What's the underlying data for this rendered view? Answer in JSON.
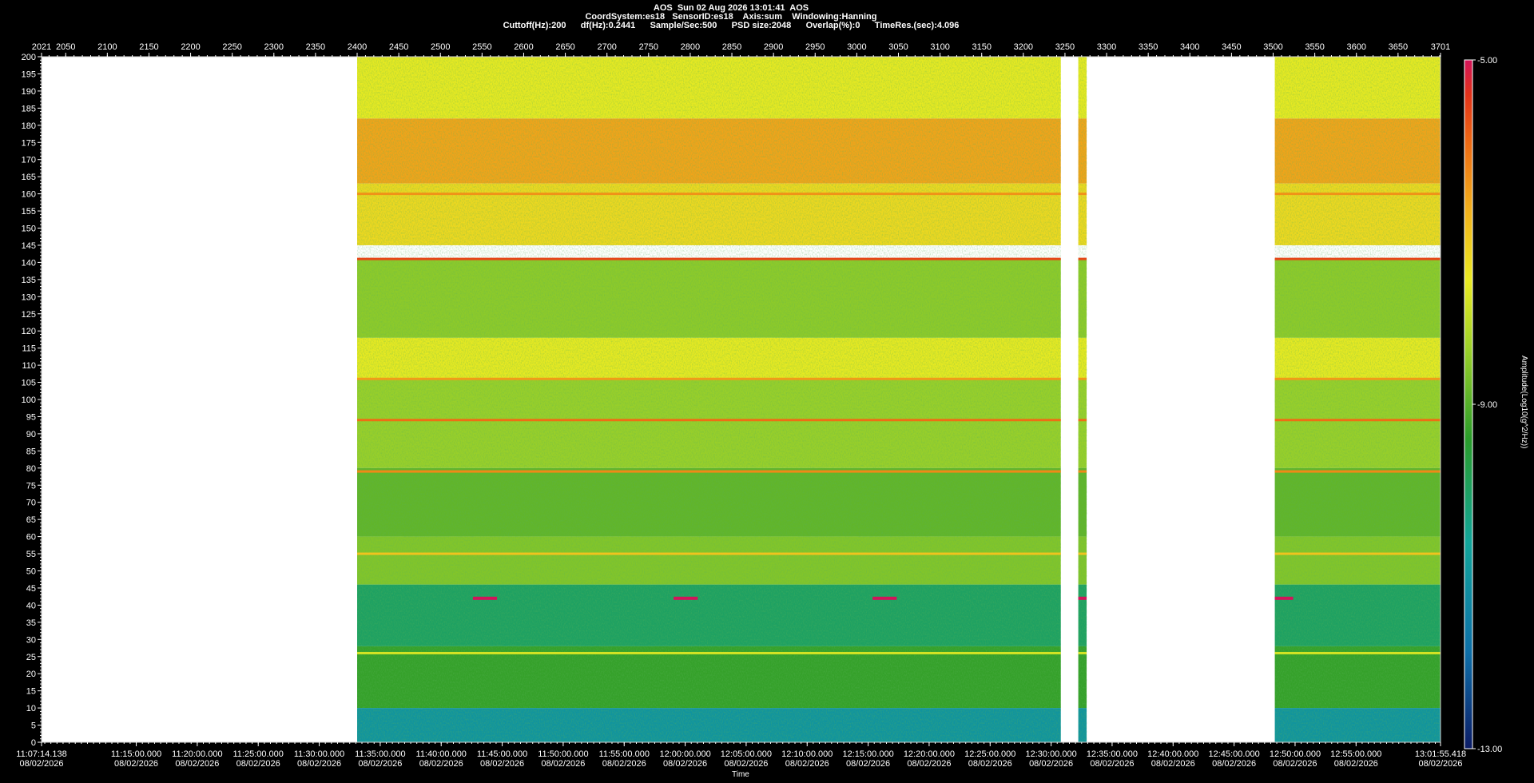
{
  "header": {
    "line1": "AOS  Sun 02 Aug 2026 13:01:41  AOS",
    "line2": "CoordSystem:es18   SensorID:es18    Axis:sum    Windowing:Hanning",
    "line3": "Cuttoff(Hz):200      df(Hz):0.2441      Sample/Sec:500      PSD size:2048      Overlap(%):0      TimeRes.(sec):4.096"
  },
  "chart_data": {
    "type": "heatmap",
    "title": "AOS  Sun 02 Aug 2026 13:01:41  AOS",
    "xlabel": "Time",
    "ylabel": "",
    "colorbar_label": "Amplitude(Log10(g^2/Hz))",
    "colorbar_ticks": [
      "-5.00",
      "-9.00",
      "-13.00"
    ],
    "colorbar_range": [
      -13,
      -5
    ],
    "ylim": [
      0,
      200
    ],
    "y_ticks": [
      0,
      5,
      10,
      15,
      20,
      25,
      30,
      35,
      40,
      45,
      50,
      55,
      60,
      65,
      70,
      75,
      80,
      85,
      90,
      95,
      100,
      105,
      110,
      115,
      120,
      125,
      130,
      135,
      140,
      145,
      150,
      155,
      160,
      165,
      170,
      175,
      180,
      185,
      190,
      195,
      200
    ],
    "top_axis_range": [
      2021,
      3701
    ],
    "top_axis_ticks": [
      2021,
      2050,
      2100,
      2150,
      2200,
      2250,
      2300,
      2350,
      2400,
      2450,
      2500,
      2550,
      2600,
      2650,
      2700,
      2750,
      2800,
      2850,
      2900,
      2950,
      3000,
      3050,
      3100,
      3150,
      3200,
      3250,
      3300,
      3350,
      3400,
      3450,
      3500,
      3550,
      3600,
      3650,
      3701
    ],
    "time_ticks": [
      {
        "time": "11:07:14.138",
        "date": "08/02/2026"
      },
      {
        "time": "11:15:00.000",
        "date": "08/02/2026"
      },
      {
        "time": "11:20:00.000",
        "date": "08/02/2026"
      },
      {
        "time": "11:25:00.000",
        "date": "08/02/2026"
      },
      {
        "time": "11:30:00.000",
        "date": "08/02/2026"
      },
      {
        "time": "11:35:00.000",
        "date": "08/02/2026"
      },
      {
        "time": "11:40:00.000",
        "date": "08/02/2026"
      },
      {
        "time": "11:45:00.000",
        "date": "08/02/2026"
      },
      {
        "time": "11:50:00.000",
        "date": "08/02/2026"
      },
      {
        "time": "11:55:00.000",
        "date": "08/02/2026"
      },
      {
        "time": "12:00:00.000",
        "date": "08/02/2026"
      },
      {
        "time": "12:05:00.000",
        "date": "08/02/2026"
      },
      {
        "time": "12:10:00.000",
        "date": "08/02/2026"
      },
      {
        "time": "12:15:00.000",
        "date": "08/02/2026"
      },
      {
        "time": "12:20:00.000",
        "date": "08/02/2026"
      },
      {
        "time": "12:25:00.000",
        "date": "08/02/2026"
      },
      {
        "time": "12:30:00.000",
        "date": "08/02/2026"
      },
      {
        "time": "12:35:00.000",
        "date": "08/02/2026"
      },
      {
        "time": "12:40:00.000",
        "date": "08/02/2026"
      },
      {
        "time": "12:45:00.000",
        "date": "08/02/2026"
      },
      {
        "time": "12:50:00.000",
        "date": "08/02/2026"
      },
      {
        "time": "12:55:00.000",
        "date": "08/02/2026"
      },
      {
        "time": "13:01:55.418",
        "date": "08/02/2026"
      }
    ],
    "data_segments": [
      {
        "start": 2400,
        "end": 3245
      },
      {
        "start": 3266,
        "end": 3276
      },
      {
        "start": 3502,
        "end": 3701
      }
    ],
    "bands": [
      {
        "y0": 163,
        "y1": 182,
        "level": -6.6
      },
      {
        "y0": 145,
        "y1": 163,
        "level": -7.3
      },
      {
        "y0": 182,
        "y1": 200,
        "level": -7.6
      },
      {
        "y0": 106,
        "y1": 118,
        "level": -7.6
      },
      {
        "y0": 118,
        "y1": 141,
        "level": -8.5
      },
      {
        "y0": 80,
        "y1": 106,
        "level": -8.4
      },
      {
        "y0": 60,
        "y1": 80,
        "level": -8.9
      },
      {
        "y0": 46,
        "y1": 60,
        "level": -8.6
      },
      {
        "y0": 28,
        "y1": 46,
        "level": -10.0
      },
      {
        "y0": 10,
        "y1": 28,
        "level": -9.3
      },
      {
        "y0": 0,
        "y1": 10,
        "level": -11.0
      }
    ],
    "lines": [
      {
        "y": 141,
        "level": -5.6
      },
      {
        "y": 94,
        "level": -6.0
      },
      {
        "y": 79,
        "level": -6.3
      },
      {
        "y": 55,
        "level": -7.0
      },
      {
        "y": 26,
        "level": -7.8
      },
      {
        "y": 106,
        "level": -6.5
      },
      {
        "y": 160,
        "level": -6.4
      }
    ],
    "markers": [
      {
        "x0": 2539,
        "x1": 2568,
        "y": 42,
        "level": -5.0
      },
      {
        "x0": 2780,
        "x1": 2809,
        "y": 42,
        "level": -5.0
      },
      {
        "x0": 3019,
        "x1": 3048,
        "y": 42,
        "level": -5.0
      },
      {
        "x0": 3266,
        "x1": 3276,
        "y": 42,
        "level": -5.0
      },
      {
        "x0": 3502,
        "x1": 3524,
        "y": 42,
        "level": -5.0
      }
    ],
    "grid": false,
    "legend": "none"
  }
}
